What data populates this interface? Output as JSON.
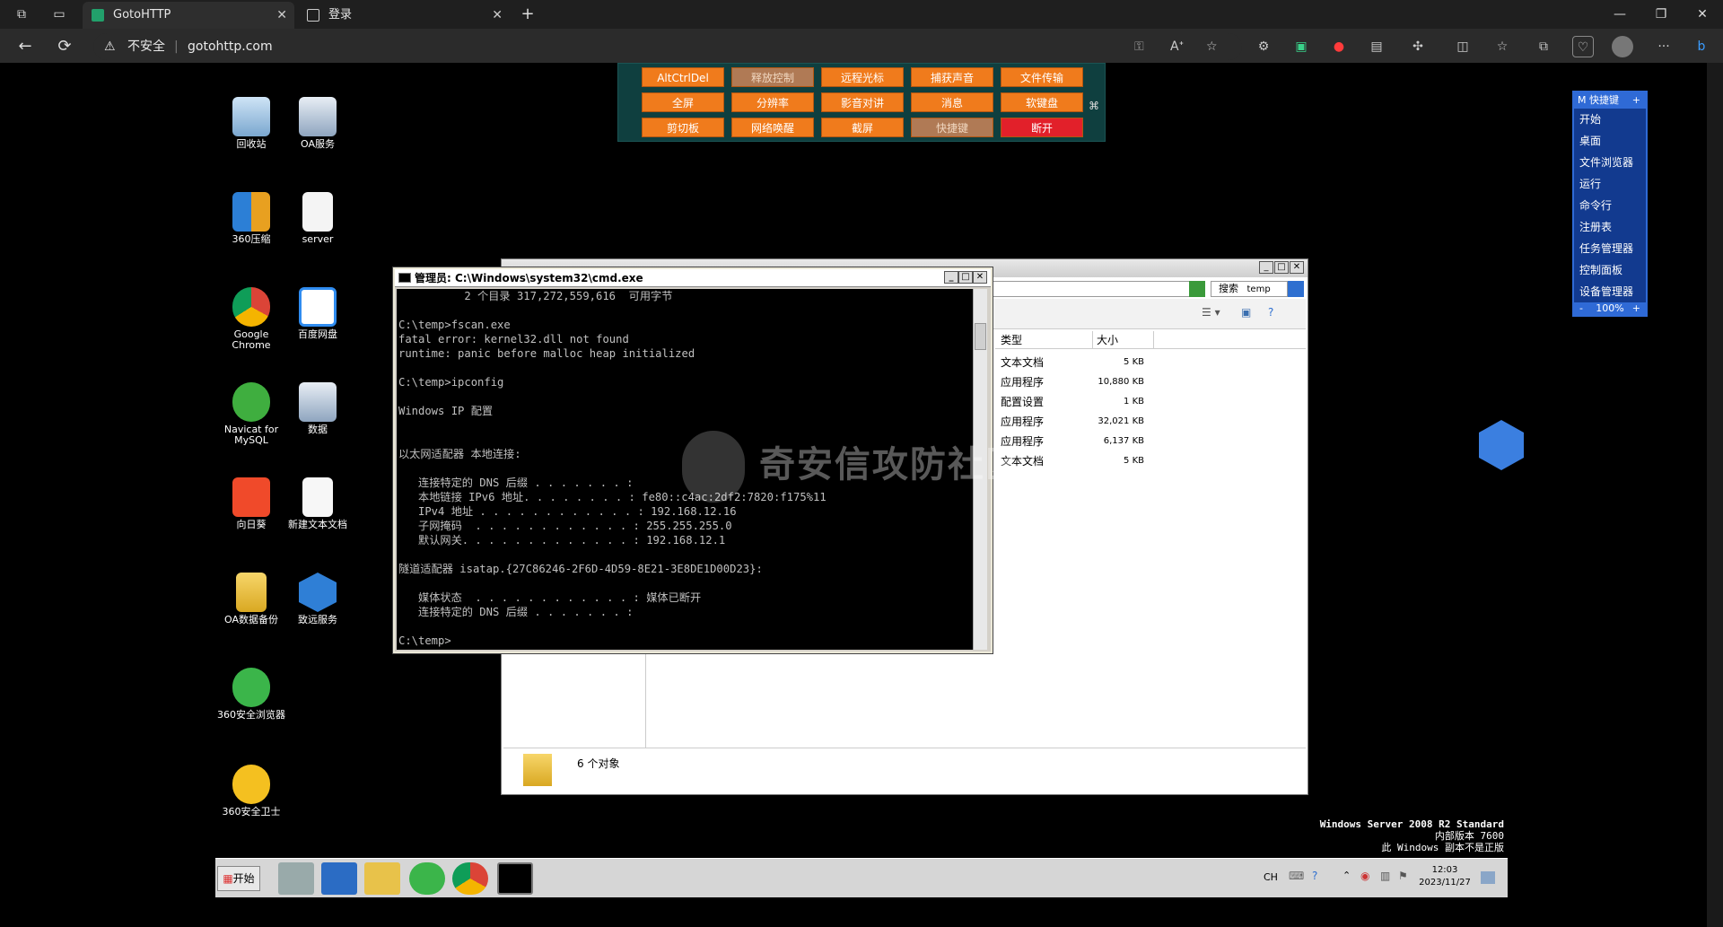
{
  "browser": {
    "tabs": [
      {
        "label": "GotoHTTP",
        "active": true
      },
      {
        "label": "登录",
        "active": false
      }
    ],
    "security_label": "不安全",
    "url": "gotohttp.com"
  },
  "toolbar": {
    "buttons_row1": [
      "AltCtrlDel",
      "释放控制",
      "远程光标",
      "捕获声音",
      "文件传输"
    ],
    "buttons_row2": [
      "全屏",
      "分辨率",
      "影音对讲",
      "消息",
      "软键盘"
    ],
    "buttons_row3": [
      "剪切板",
      "网络唤醒",
      "截屏",
      "快捷键",
      "断开"
    ],
    "pin_glyph": "⌘"
  },
  "quick_panel": {
    "title": "M  快捷键",
    "add": "+",
    "items": [
      "开始",
      "桌面",
      "文件浏览器",
      "运行",
      "命令行",
      "注册表",
      "任务管理器",
      "控制面板",
      "设备管理器"
    ],
    "zoom_minus": "-",
    "zoom": "100%",
    "zoom_plus": "+"
  },
  "desktop_icons": [
    {
      "label": "回收站"
    },
    {
      "label": "OA服务"
    },
    {
      "label": "360压缩"
    },
    {
      "label": "server"
    },
    {
      "label": "Google Chrome"
    },
    {
      "label": "百度网盘"
    },
    {
      "label": "Navicat for MySQL"
    },
    {
      "label": "数据"
    },
    {
      "label": "向日葵"
    },
    {
      "label": "新建文本文档"
    },
    {
      "label": "OA数据备份"
    },
    {
      "label": "致远服务"
    },
    {
      "label": "360安全浏览器"
    },
    {
      "label": "360安全卫士"
    }
  ],
  "explorer": {
    "search_label": "搜索",
    "search_value": "temp",
    "col_type": "类型",
    "col_size": "大小",
    "rows": [
      {
        "type": "文本文档",
        "size": "5 KB"
      },
      {
        "type": "应用程序",
        "size": "10,880 KB"
      },
      {
        "type": "配置设置",
        "size": "1 KB"
      },
      {
        "type": "应用程序",
        "size": "32,021 KB"
      },
      {
        "type": "应用程序",
        "size": "6,137 KB"
      },
      {
        "type": "文本文档",
        "size": "5 KB"
      }
    ],
    "status": "6 个对象"
  },
  "cmd": {
    "title": "管理员: C:\\Windows\\system32\\cmd.exe",
    "lines": [
      "          2 个目录 317,272,559,616  可用字节",
      "",
      "C:\\temp>fscan.exe",
      "fatal error: kernel32.dll not found",
      "runtime: panic before malloc heap initialized",
      "",
      "C:\\temp>ipconfig",
      "",
      "Windows IP 配置",
      "",
      "",
      "以太网适配器 本地连接:",
      "",
      "   连接特定的 DNS 后缀 . . . . . . . :",
      "   本地链接 IPv6 地址. . . . . . . . : fe80::c4ac:2df2:7820:f175%11",
      "   IPv4 地址 . . . . . . . . . . . . : 192.168.12.16",
      "   子网掩码  . . . . . . . . . . . . : 255.255.255.0",
      "   默认网关. . . . . . . . . . . . . : 192.168.12.1",
      "",
      "隧道适配器 isatap.{27C86246-2F6D-4D59-8E21-3E8DE1D00D23}:",
      "",
      "   媒体状态  . . . . . . . . . . . . : 媒体已断开",
      "   连接特定的 DNS 后缀 . . . . . . . :",
      "",
      "C:\\temp>"
    ]
  },
  "watermark": "奇安信攻防社区",
  "windows_info": {
    "line1": "Windows Server 2008 R2 Standard",
    "line2": "内部版本 7600",
    "line3": "此 Windows 副本不是正版"
  },
  "taskbar": {
    "start_label": "开始",
    "lang": "CH",
    "time": "12:03",
    "date": "2023/11/27"
  },
  "colors": {
    "toolbar_button": "#f07b1c",
    "disconnect": "#e2202a",
    "quick_panel": "#123a8f"
  }
}
